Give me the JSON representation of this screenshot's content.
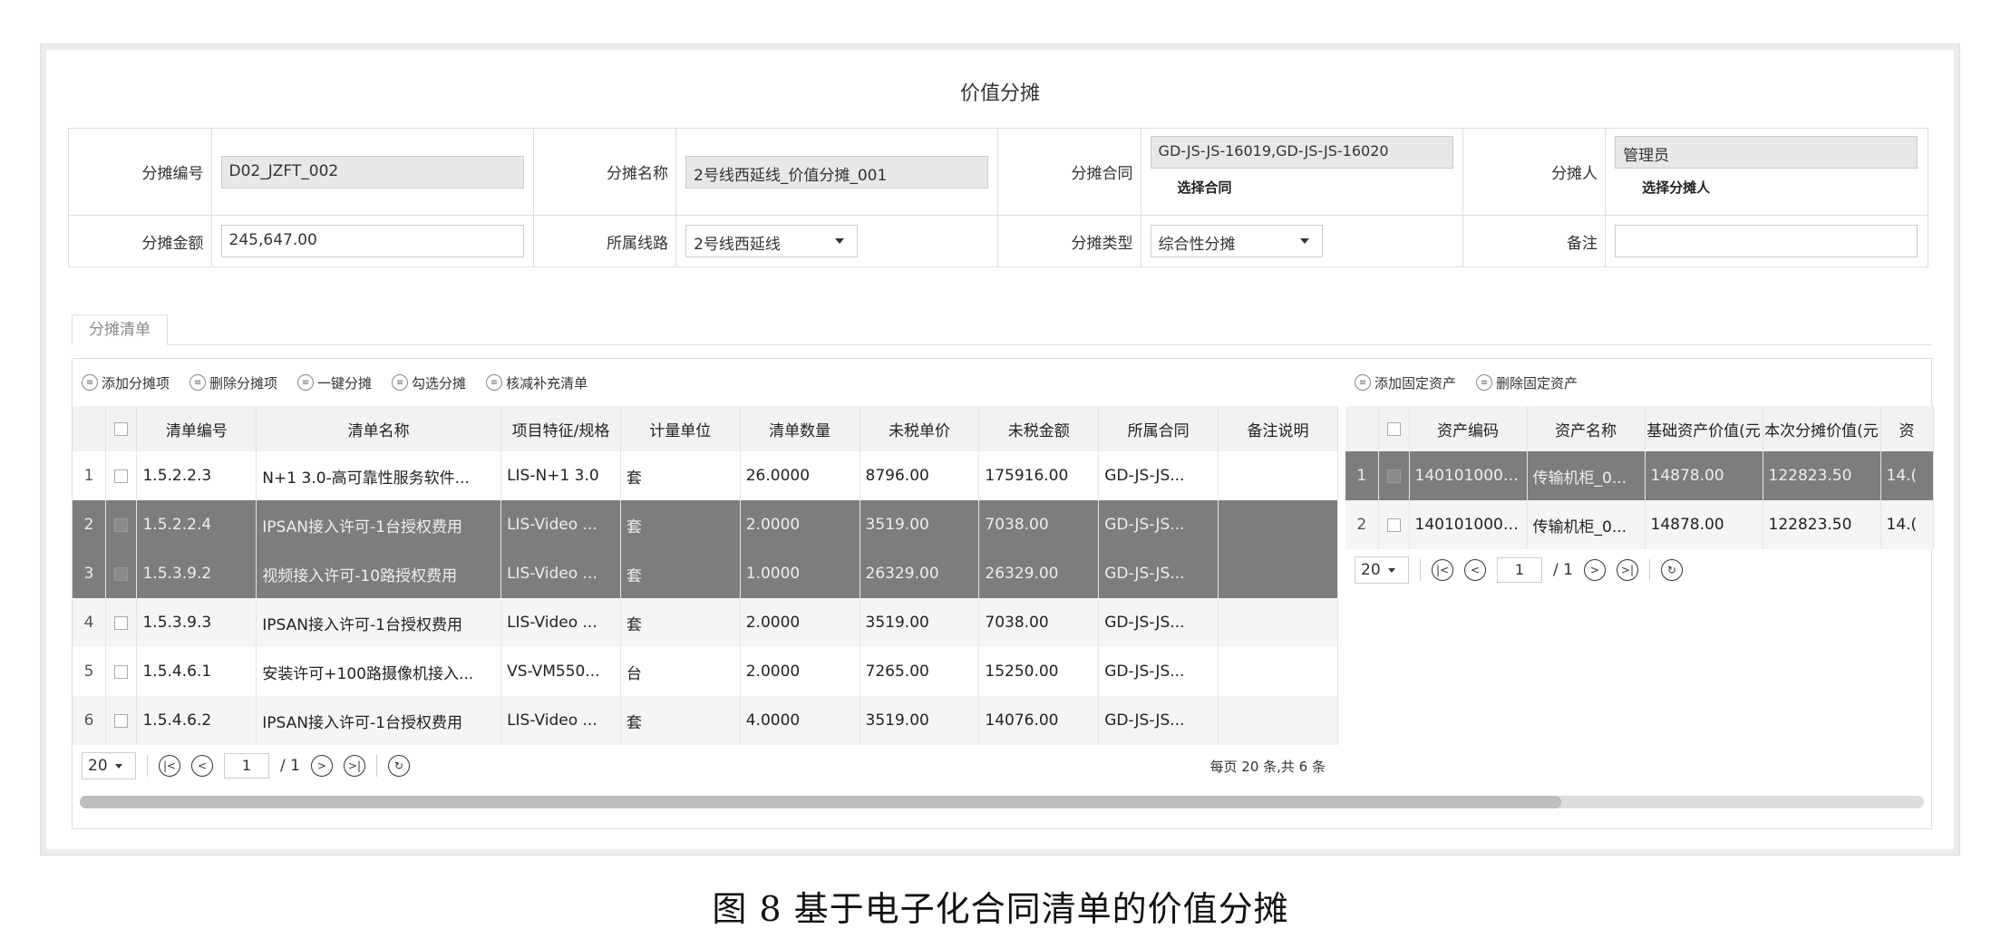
{
  "page_title": "价值分摊",
  "form": {
    "code_label": "分摊编号",
    "code_value": "D02_JZFT_002",
    "name_label": "分摊名称",
    "name_value": "2号线西延线_价值分摊_001",
    "contract_label": "分摊合同",
    "contract_value": "GD-JS-JS-16019,GD-JS-JS-16020",
    "contract_link": "选择合同",
    "person_label": "分摊人",
    "person_value": "管理员",
    "person_link": "选择分摊人",
    "amount_label": "分摊金额",
    "amount_value": "245,647.00",
    "line_label": "所属线路",
    "line_value": "2号线西延线",
    "type_label": "分摊类型",
    "type_value": "综合性分摊",
    "remark_label": "备注",
    "remark_value": ""
  },
  "tabs": [
    {
      "label": "分摊清单"
    }
  ],
  "left_toolbar": [
    {
      "label": "添加分摊项"
    },
    {
      "label": "删除分摊项"
    },
    {
      "label": "一键分摊"
    },
    {
      "label": "勾选分摊"
    },
    {
      "label": "核减补充清单"
    }
  ],
  "left_table": {
    "headers": [
      "清单编号",
      "清单名称",
      "项目特征/规格",
      "计量单位",
      "清单数量",
      "未税单价",
      "未税金额",
      "所属合同",
      "备注说明"
    ],
    "rows": [
      {
        "n": "1",
        "c": [
          "1.5.2.2.3",
          "N+1 3.0-高可靠性服务软件...",
          "LIS-N+1 3.0",
          "套",
          "26.0000",
          "8796.00",
          "175916.00",
          "GD-JS-JS...",
          ""
        ]
      },
      {
        "n": "2",
        "c": [
          "1.5.2.2.4",
          "IPSAN接入许可-1台授权费用",
          "LIS-Video ...",
          "套",
          "2.0000",
          "3519.00",
          "7038.00",
          "GD-JS-JS...",
          ""
        ]
      },
      {
        "n": "3",
        "c": [
          "1.5.3.9.2",
          "视频接入许可-10路授权费用",
          "LIS-Video ...",
          "套",
          "1.0000",
          "26329.00",
          "26329.00",
          "GD-JS-JS...",
          ""
        ]
      },
      {
        "n": "4",
        "c": [
          "1.5.3.9.3",
          "IPSAN接入许可-1台授权费用",
          "LIS-Video ...",
          "套",
          "2.0000",
          "3519.00",
          "7038.00",
          "GD-JS-JS...",
          ""
        ]
      },
      {
        "n": "5",
        "c": [
          "1.5.4.6.1",
          "安装许可+100路摄像机接入...",
          "VS-VM550...",
          "台",
          "2.0000",
          "7265.00",
          "15250.00",
          "GD-JS-JS...",
          ""
        ]
      },
      {
        "n": "6",
        "c": [
          "1.5.4.6.2",
          "IPSAN接入许可-1台授权费用",
          "LIS-Video ...",
          "套",
          "4.0000",
          "3519.00",
          "14076.00",
          "GD-JS-JS...",
          ""
        ]
      }
    ]
  },
  "left_pager": {
    "page_size": "20",
    "current": "1",
    "total": "/ 1",
    "info": "每页 20 条,共 6 条"
  },
  "right_toolbar": [
    {
      "label": "添加固定资产"
    },
    {
      "label": "删除固定资产"
    }
  ],
  "right_table": {
    "headers": [
      "资产编码",
      "资产名称",
      "基础资产价值(元",
      "本次分摊价值(元",
      "资"
    ],
    "rows": [
      {
        "n": "1",
        "c": [
          "1401010000...",
          "传输机柜_0...",
          "14878.00",
          "122823.50",
          "14.("
        ]
      },
      {
        "n": "2",
        "c": [
          "1401010000...",
          "传输机柜_0...",
          "14878.00",
          "122823.50",
          "14.("
        ]
      }
    ]
  },
  "right_pager": {
    "page_size": "20",
    "current": "1",
    "total": "/ 1"
  },
  "caption": "图 8    基于电子化合同清单的价值分摊"
}
